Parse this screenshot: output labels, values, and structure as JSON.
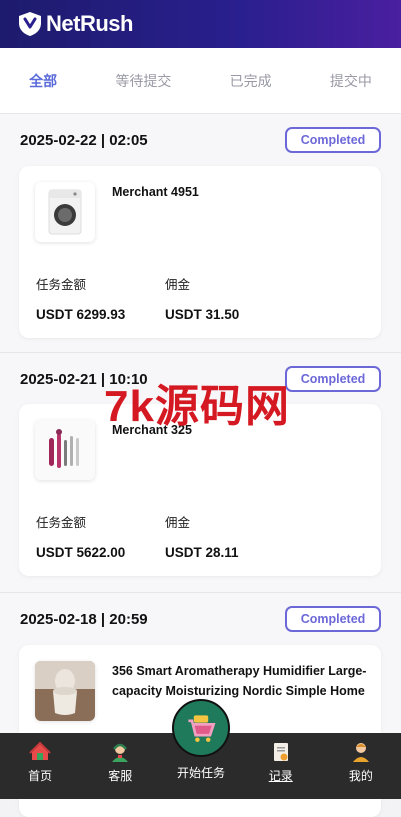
{
  "header": {
    "app_name": "NetRush",
    "brand_color": "#2a1f8e"
  },
  "tabs": [
    {
      "label": "全部",
      "active": true
    },
    {
      "label": "等待提交",
      "active": false
    },
    {
      "label": "已完成",
      "active": false
    },
    {
      "label": "提交中",
      "active": false
    }
  ],
  "orders": [
    {
      "time": "2025-02-22 | 02:05",
      "status": "Completed",
      "merchant": "Merchant 4951",
      "image_icon": "washing-machine-icon",
      "task_amount_label": "任务金额",
      "task_amount": "USDT 6299.93",
      "commission_label": "佣金",
      "commission": "USDT 31.50"
    },
    {
      "time": "2025-02-21 | 10:10",
      "status": "Completed",
      "merchant": "Merchant 325",
      "image_icon": "hair-styler-icon",
      "task_amount_label": "任务金额",
      "task_amount": "USDT 5622.00",
      "commission_label": "佣金",
      "commission": "USDT 28.11"
    },
    {
      "time": "2025-02-18 | 20:59",
      "status": "Completed",
      "merchant": "356 Smart Aromatherapy Humidifier Large-capacity Moisturizing Nordic Simple Home",
      "image_icon": "humidifier-icon"
    }
  ],
  "watermark": "7k源码网",
  "bottom_nav": [
    {
      "label": "首页",
      "icon": "home-icon"
    },
    {
      "label": "客服",
      "icon": "support-agent-icon"
    },
    {
      "label": "开始任务",
      "icon": "shopping-cart-icon"
    },
    {
      "label": "记录",
      "icon": "record-icon"
    },
    {
      "label": "我的",
      "icon": "profile-icon"
    }
  ]
}
